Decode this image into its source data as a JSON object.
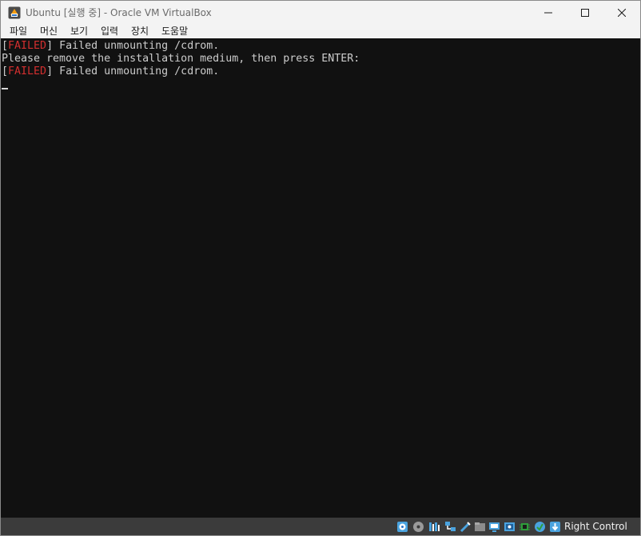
{
  "window": {
    "title": "Ubuntu [실행 중] - Oracle VM VirtualBox",
    "controls": {
      "minimize": "minimize",
      "maximize": "maximize",
      "close": "close"
    }
  },
  "menu": {
    "items": [
      {
        "label": "파일"
      },
      {
        "label": "머신"
      },
      {
        "label": "보기"
      },
      {
        "label": "입력"
      },
      {
        "label": "장치"
      },
      {
        "label": "도움말"
      }
    ]
  },
  "console": {
    "lines": [
      {
        "open": "[",
        "status": "FAILED",
        "close": "]",
        "text": " Failed unmounting /cdrom."
      },
      {
        "text": "Please remove the installation medium, then press ENTER:"
      },
      {
        "open": "[",
        "status": "FAILED",
        "close": "]",
        "text": " Failed unmounting /cdrom."
      }
    ],
    "status_color": "#d32f2f",
    "text_color": "#cccccc"
  },
  "statusbar": {
    "icons": [
      "hard-disk-icon",
      "optical-drive-icon",
      "audio-icon",
      "network-icon",
      "usb-icon",
      "shared-folders-icon",
      "display-icon",
      "recording-icon",
      "cpu-icon",
      "guest-additions-icon",
      "mouse-integration-icon"
    ],
    "host_key": "Right Control"
  }
}
